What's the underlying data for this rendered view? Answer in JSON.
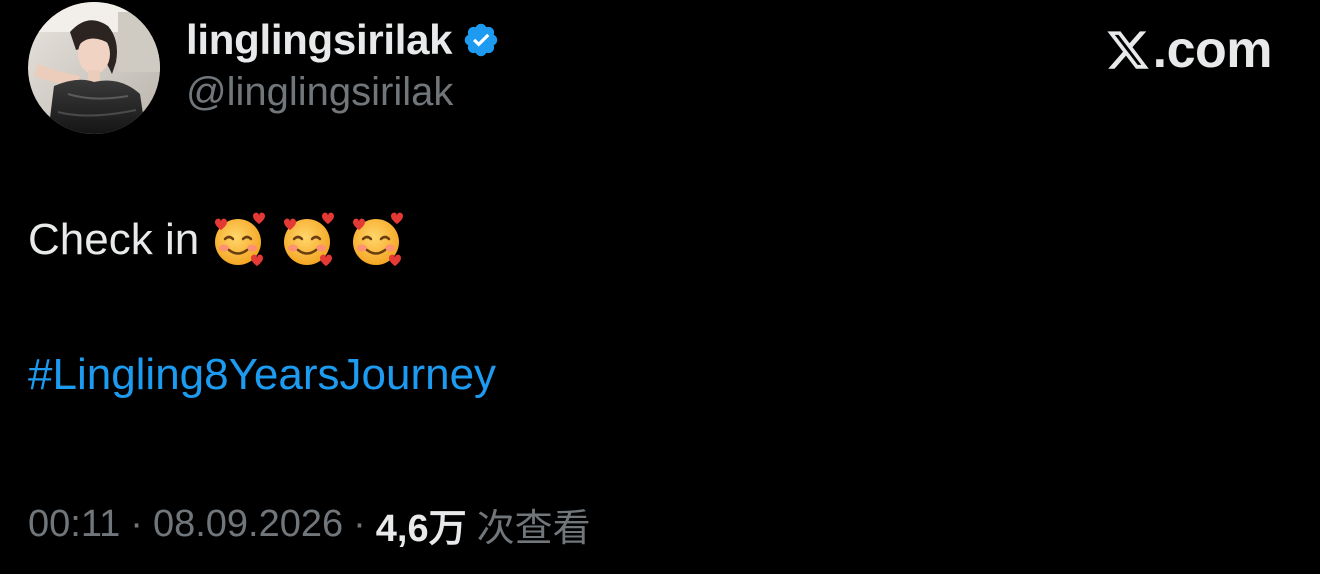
{
  "author": {
    "display_name": "linglingsirilak",
    "handle": "@linglingsirilak",
    "verified": true,
    "avatar_icon": "profile-photo"
  },
  "brand": {
    "icon": "x-logo-icon",
    "text": ".com"
  },
  "tweet": {
    "text": "Check in",
    "emojis": [
      "smiling-face-with-hearts",
      "smiling-face-with-hearts",
      "smiling-face-with-hearts"
    ],
    "hashtag": "#Lingling8YearsJourney"
  },
  "meta": {
    "time": "00:11",
    "separator": "·",
    "date": "08.09.2026",
    "views_count": "4,6万",
    "views_label": "次查看"
  },
  "colors": {
    "background": "#000000",
    "primary_text": "#e7e9ea",
    "secondary_text": "#71767b",
    "link": "#1d9bf0",
    "verified_badge": "#1d9bf0"
  }
}
